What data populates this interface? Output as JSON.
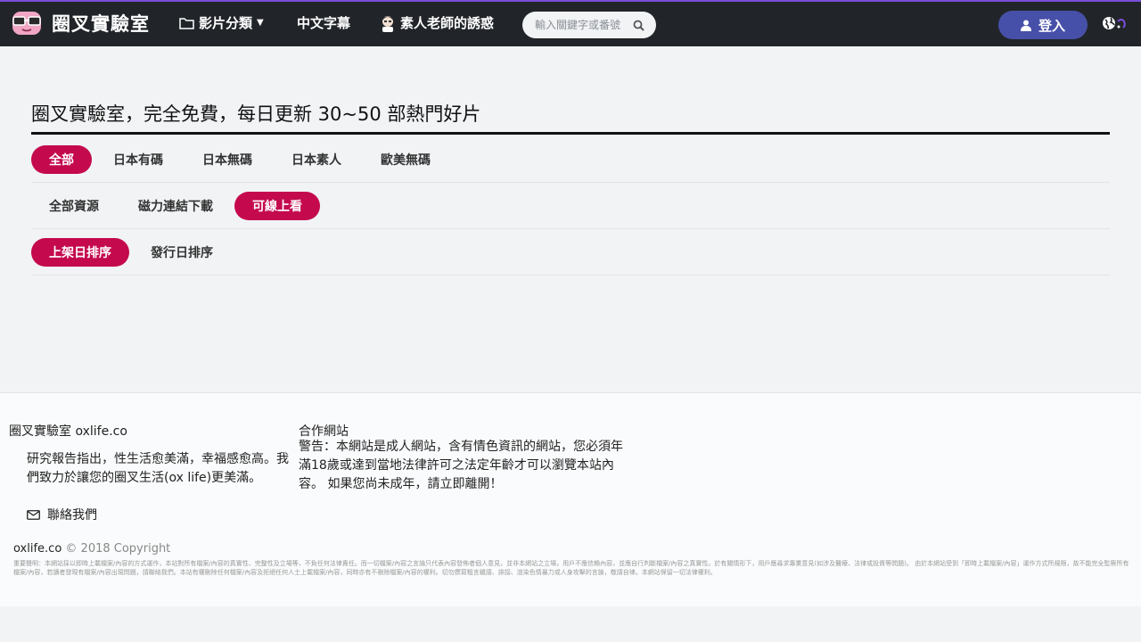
{
  "header": {
    "site_name": "圈叉實驗室",
    "nav": {
      "categories": "影片分類",
      "subtitles": "中文字幕",
      "amateur": "素人老師的誘惑"
    },
    "search_placeholder": "輸入關鍵字或番號",
    "login_label": "登入"
  },
  "main": {
    "title": "圈叉實驗室，完全免費，每日更新 30~50 部熱門好片",
    "category_filters": [
      "全部",
      "日本有碼",
      "日本無碼",
      "日本素人",
      "歐美無碼"
    ],
    "category_active": 0,
    "resource_filters": [
      "全部資源",
      "磁力連結下載",
      "可線上看"
    ],
    "resource_active": 2,
    "sort_filters": [
      "上架日排序",
      "發行日排序"
    ],
    "sort_active": 0
  },
  "footer": {
    "brand_line": "圈叉實驗室 oxlife.co",
    "about": "研究報告指出，性生活愈美滿，幸福感愈高。我們致力於讓您的圈叉生活(ox life)更美滿。",
    "contact_label": "聯絡我們",
    "partners_title": "合作網站",
    "warning": "警告：本網站是成人網站，含有情色資訊的網站，您必須年滿18歲或達到當地法律許可之法定年齡才可以瀏覽本站內容。 如果您尚未成年，請立即離開！",
    "copyright_site": "oxlife.co",
    "copyright_rest": " © 2018 Copyright",
    "disclaimer": "重要聲明：本網站採以即時上載檔案/內容的方式運作，本站對所有檔案/內容的真實性、完整性及立場等，不負任何法律責任。而一切檔案/內容之言論只代表內容發佈者個人意見，並非本網站之立場，用戶不應信賴內容，並應自行判斷檔案/內容之真實性。於有關情形下，用戶應尋求專業意見(如涉及醫療、法律或投資等問題)。 由於本網站受到「即時上載檔案/內容」運作方式所規限，故不能完全監察所有檔案/內容，若讀者發現有檔案/內容出現問題，請聯絡我們。本站有權刪除任何檔案/內容及拒絕任何人士上載檔案/內容，同時亦有不刪除檔案/內容的權利。切勿撰寫粗言穢語、誹謗、渲染色情暴力或人身攻擊的言論，敬請自律。本網站保留一切法律權利。"
  },
  "colors": {
    "header_bg": "#212529",
    "accent_top": "#7b4fd8",
    "active_pill": "#c4094d",
    "login_btn": "#4750a8"
  },
  "icons": {
    "logo": "glasses-face-icon",
    "categories": "folder-icon",
    "amateur": "teacher-avatar-icon",
    "search": "search-icon",
    "login": "user-icon",
    "language": "globe-icon",
    "contact": "envelope-icon"
  }
}
